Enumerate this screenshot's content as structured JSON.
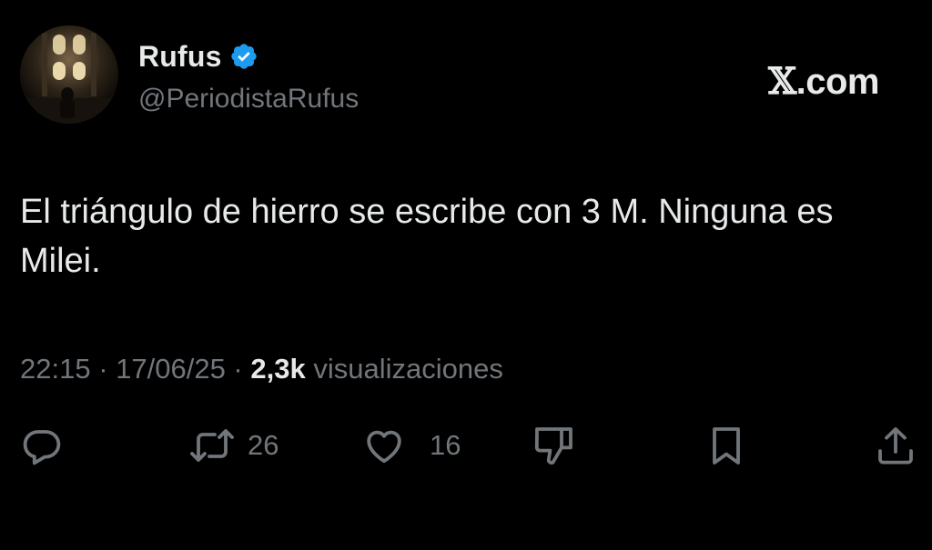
{
  "author": {
    "display_name": "Rufus",
    "handle": "@PeriodistaRufus",
    "verified": true,
    "verified_color": "#1d9bf0"
  },
  "brand": {
    "mark": "𝕏",
    "suffix": ".com"
  },
  "tweet": {
    "text": "El triángulo de hierro se escribe con 3 M. Ninguna es Milei."
  },
  "meta": {
    "time": "22:15",
    "separator": " · ",
    "date": "17/06/25",
    "views_count": "2,3k",
    "views_label": "visualizaciones"
  },
  "actions": {
    "reply": {
      "icon": "reply-icon",
      "count": ""
    },
    "retweet": {
      "icon": "retweet-icon",
      "count": "26"
    },
    "like": {
      "icon": "heart-icon",
      "count": "16"
    },
    "dislike": {
      "icon": "thumbs-down-icon",
      "count": ""
    },
    "bookmark": {
      "icon": "bookmark-icon",
      "count": ""
    },
    "share": {
      "icon": "share-icon",
      "count": ""
    }
  },
  "colors": {
    "background": "#000000",
    "primary_text": "#e7e9ea",
    "secondary_text": "#71767b"
  }
}
